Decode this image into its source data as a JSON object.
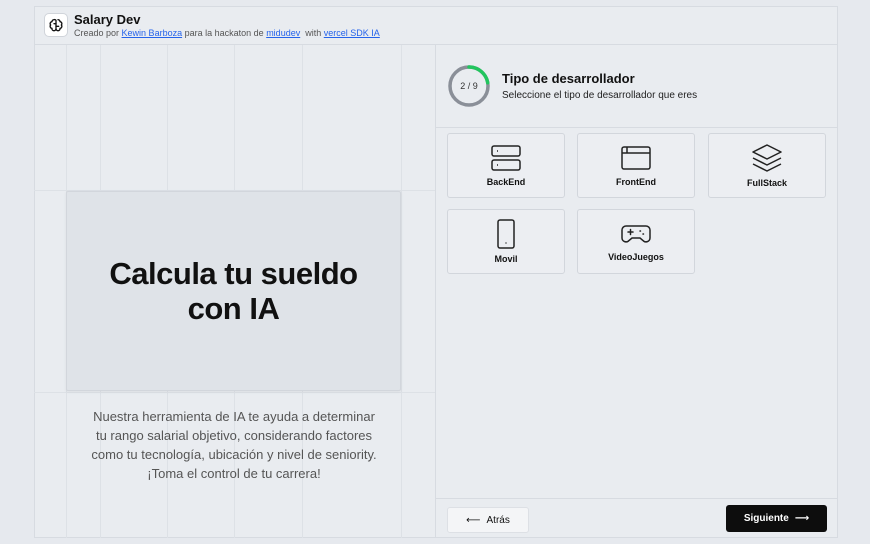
{
  "header": {
    "title": "Salary Dev",
    "credit_prefix": "Creado por",
    "author": "Kewin Barboza",
    "credit_middle": "para la hackaton de",
    "hackathon": "midudev",
    "credit_with": "with",
    "sdk": "vercel SDK IA",
    "logo_icon": "brain-icon"
  },
  "hero": {
    "title_line1": "Calcula tu sueldo",
    "title_line2": "con IA",
    "description": "Nuestra herramienta de IA te ayuda a determinar tu rango salarial objetivo, considerando factores como tu tecnología, ubicación y nivel de seniority. ¡Toma el control de tu carrera!"
  },
  "step": {
    "current": 2,
    "total": 9,
    "label": "2 / 9",
    "title": "Tipo de desarrollador",
    "subtitle": "Seleccione el tipo de desarrollador que eres",
    "progress_color": "#22c55e"
  },
  "options": [
    {
      "label": "BackEnd",
      "icon": "server-icon"
    },
    {
      "label": "FrontEnd",
      "icon": "browser-window-icon"
    },
    {
      "label": "FullStack",
      "icon": "layers-icon"
    },
    {
      "label": "Movil",
      "icon": "smartphone-icon"
    },
    {
      "label": "VideoJuegos",
      "icon": "gamepad-icon"
    }
  ],
  "footer": {
    "back_label": "Atrás",
    "next_label": "Siguiente",
    "back_icon": "arrow-left-icon",
    "next_icon": "arrow-right-icon"
  }
}
